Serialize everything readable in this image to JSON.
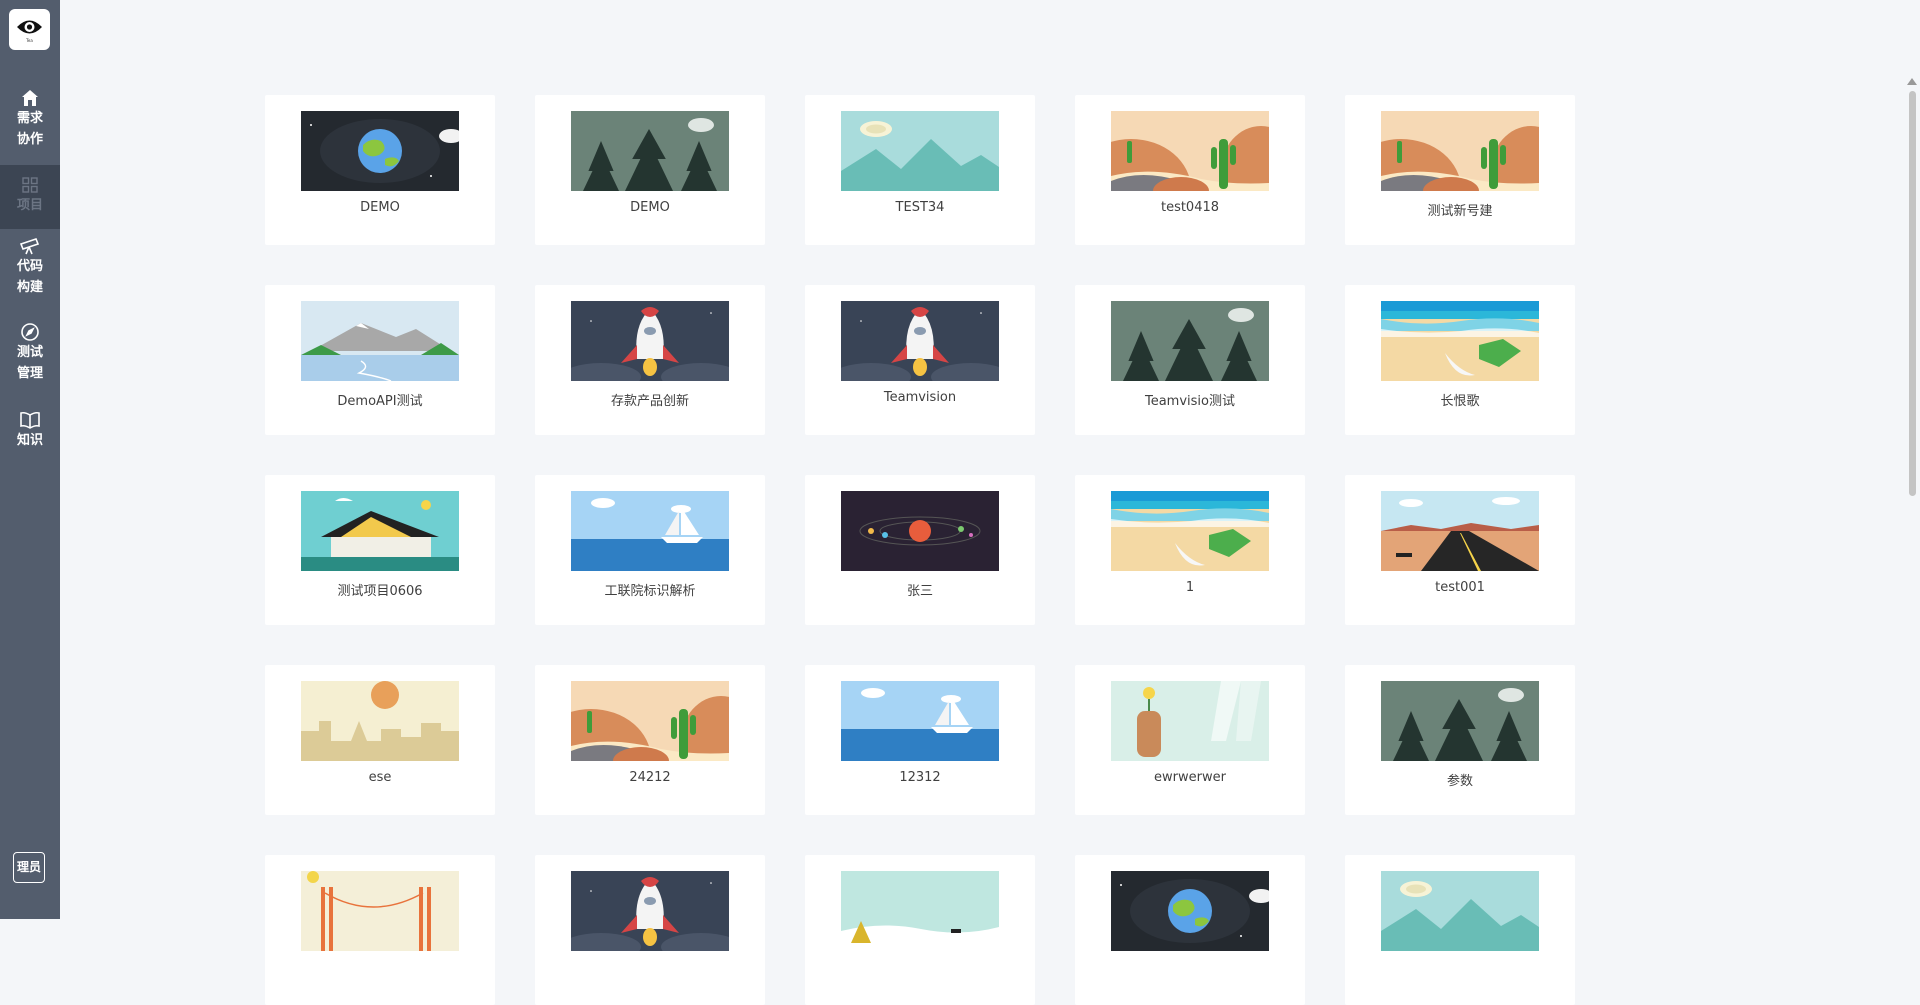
{
  "app": {
    "logo_sub": "Tea"
  },
  "sidebar": {
    "items": [
      {
        "key": "demand",
        "icon": "home-icon",
        "label": "需求\n协作",
        "active": false
      },
      {
        "key": "project",
        "icon": "grid-icon",
        "label": "项目",
        "active": true
      },
      {
        "key": "build",
        "icon": "telescope-icon",
        "label": "代码\n构建",
        "active": false
      },
      {
        "key": "test",
        "icon": "compass-icon",
        "label": "测试\n管理",
        "active": false
      },
      {
        "key": "knowledge",
        "icon": "book-icon",
        "label": "知识",
        "active": false
      }
    ],
    "admin_label": "理员"
  },
  "projects": [
    {
      "name": "DEMO",
      "theme": "earth"
    },
    {
      "name": "DEMO",
      "theme": "forest"
    },
    {
      "name": "TEST34",
      "theme": "mountain"
    },
    {
      "name": "test0418",
      "theme": "desert"
    },
    {
      "name": "测试新号建",
      "theme": "desert"
    },
    {
      "name": "DemoAPI测试",
      "theme": "lake"
    },
    {
      "name": "存款产品创新",
      "theme": "rocket"
    },
    {
      "name": "Teamvision",
      "theme": "rocket"
    },
    {
      "name": "Teamvisio测试",
      "theme": "forest"
    },
    {
      "name": "长恨歌",
      "theme": "beach"
    },
    {
      "name": "测试项目0606",
      "theme": "house"
    },
    {
      "name": "工联院标识解析",
      "theme": "sail"
    },
    {
      "name": "张三",
      "theme": "planets"
    },
    {
      "name": "1",
      "theme": "beach"
    },
    {
      "name": "test001",
      "theme": "road"
    },
    {
      "name": "ese",
      "theme": "city"
    },
    {
      "name": "24212",
      "theme": "desert"
    },
    {
      "name": "12312",
      "theme": "sail"
    },
    {
      "name": "ewrwerwer",
      "theme": "drink"
    },
    {
      "name": "参数",
      "theme": "forest"
    },
    {
      "name": "",
      "theme": "bridge"
    },
    {
      "name": "",
      "theme": "rocket"
    },
    {
      "name": "",
      "theme": "snow"
    },
    {
      "name": "",
      "theme": "earth"
    },
    {
      "name": "",
      "theme": "mountain"
    }
  ]
}
